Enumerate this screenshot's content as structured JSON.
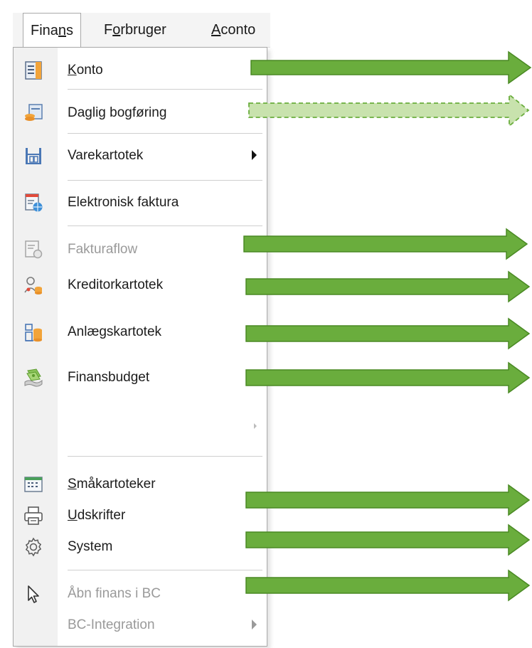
{
  "menubar": {
    "items": [
      {
        "pre": "Fina",
        "accel": "n",
        "post": "s"
      },
      {
        "pre": "F",
        "accel": "o",
        "post": "rbruger"
      },
      {
        "pre": "",
        "accel": "A",
        "post": "conto"
      }
    ]
  },
  "menu": {
    "items": [
      {
        "pre": "",
        "accel": "K",
        "post": "onto",
        "icon": "ledger-icon"
      },
      {
        "pre": "Daglig bogføring",
        "accel": "",
        "post": "",
        "icon": "journal-icon"
      },
      {
        "pre": "Varekartotek",
        "accel": "",
        "post": "",
        "icon": "warehouse-icon",
        "submenu": true
      },
      {
        "pre": "Elektronisk faktura",
        "accel": "",
        "post": "",
        "icon": "e-invoice-icon"
      },
      {
        "pre": "Fakturaflow",
        "accel": "",
        "post": "",
        "icon": "invoice-flow-icon",
        "disabled": true
      },
      {
        "pre": "Kreditorkartotek",
        "accel": "",
        "post": "",
        "icon": "creditor-icon"
      },
      {
        "pre": "Anlægskartotek",
        "accel": "",
        "post": "",
        "icon": "assets-icon"
      },
      {
        "pre": "Finansbudget",
        "accel": "",
        "post": "",
        "icon": "budget-icon"
      },
      {
        "pre": "Små",
        "accel": "",
        "post": "kartoteker",
        "icon": "small-registers-icon",
        "underline_pre": "S"
      },
      {
        "pre": "",
        "accel": "U",
        "post": "dskrifter",
        "icon": "printer-icon"
      },
      {
        "pre": "System",
        "accel": "",
        "post": "",
        "icon": "gear-icon"
      },
      {
        "pre": "Åbn finans i BC",
        "accel": "",
        "post": "",
        "icon": "cursor-icon",
        "disabled": true
      },
      {
        "pre": "BC-Integration",
        "accel": "",
        "post": "",
        "icon": "",
        "disabled": true,
        "submenu": true
      }
    ]
  },
  "colors": {
    "arrow_fill": "#6aad3d",
    "arrow_stroke": "#4a8a24",
    "arrow_dashed_fill": "#c8e2ad",
    "arrow_dashed_stroke": "#6aad3d",
    "disabled_text": "#9a9a9a"
  }
}
